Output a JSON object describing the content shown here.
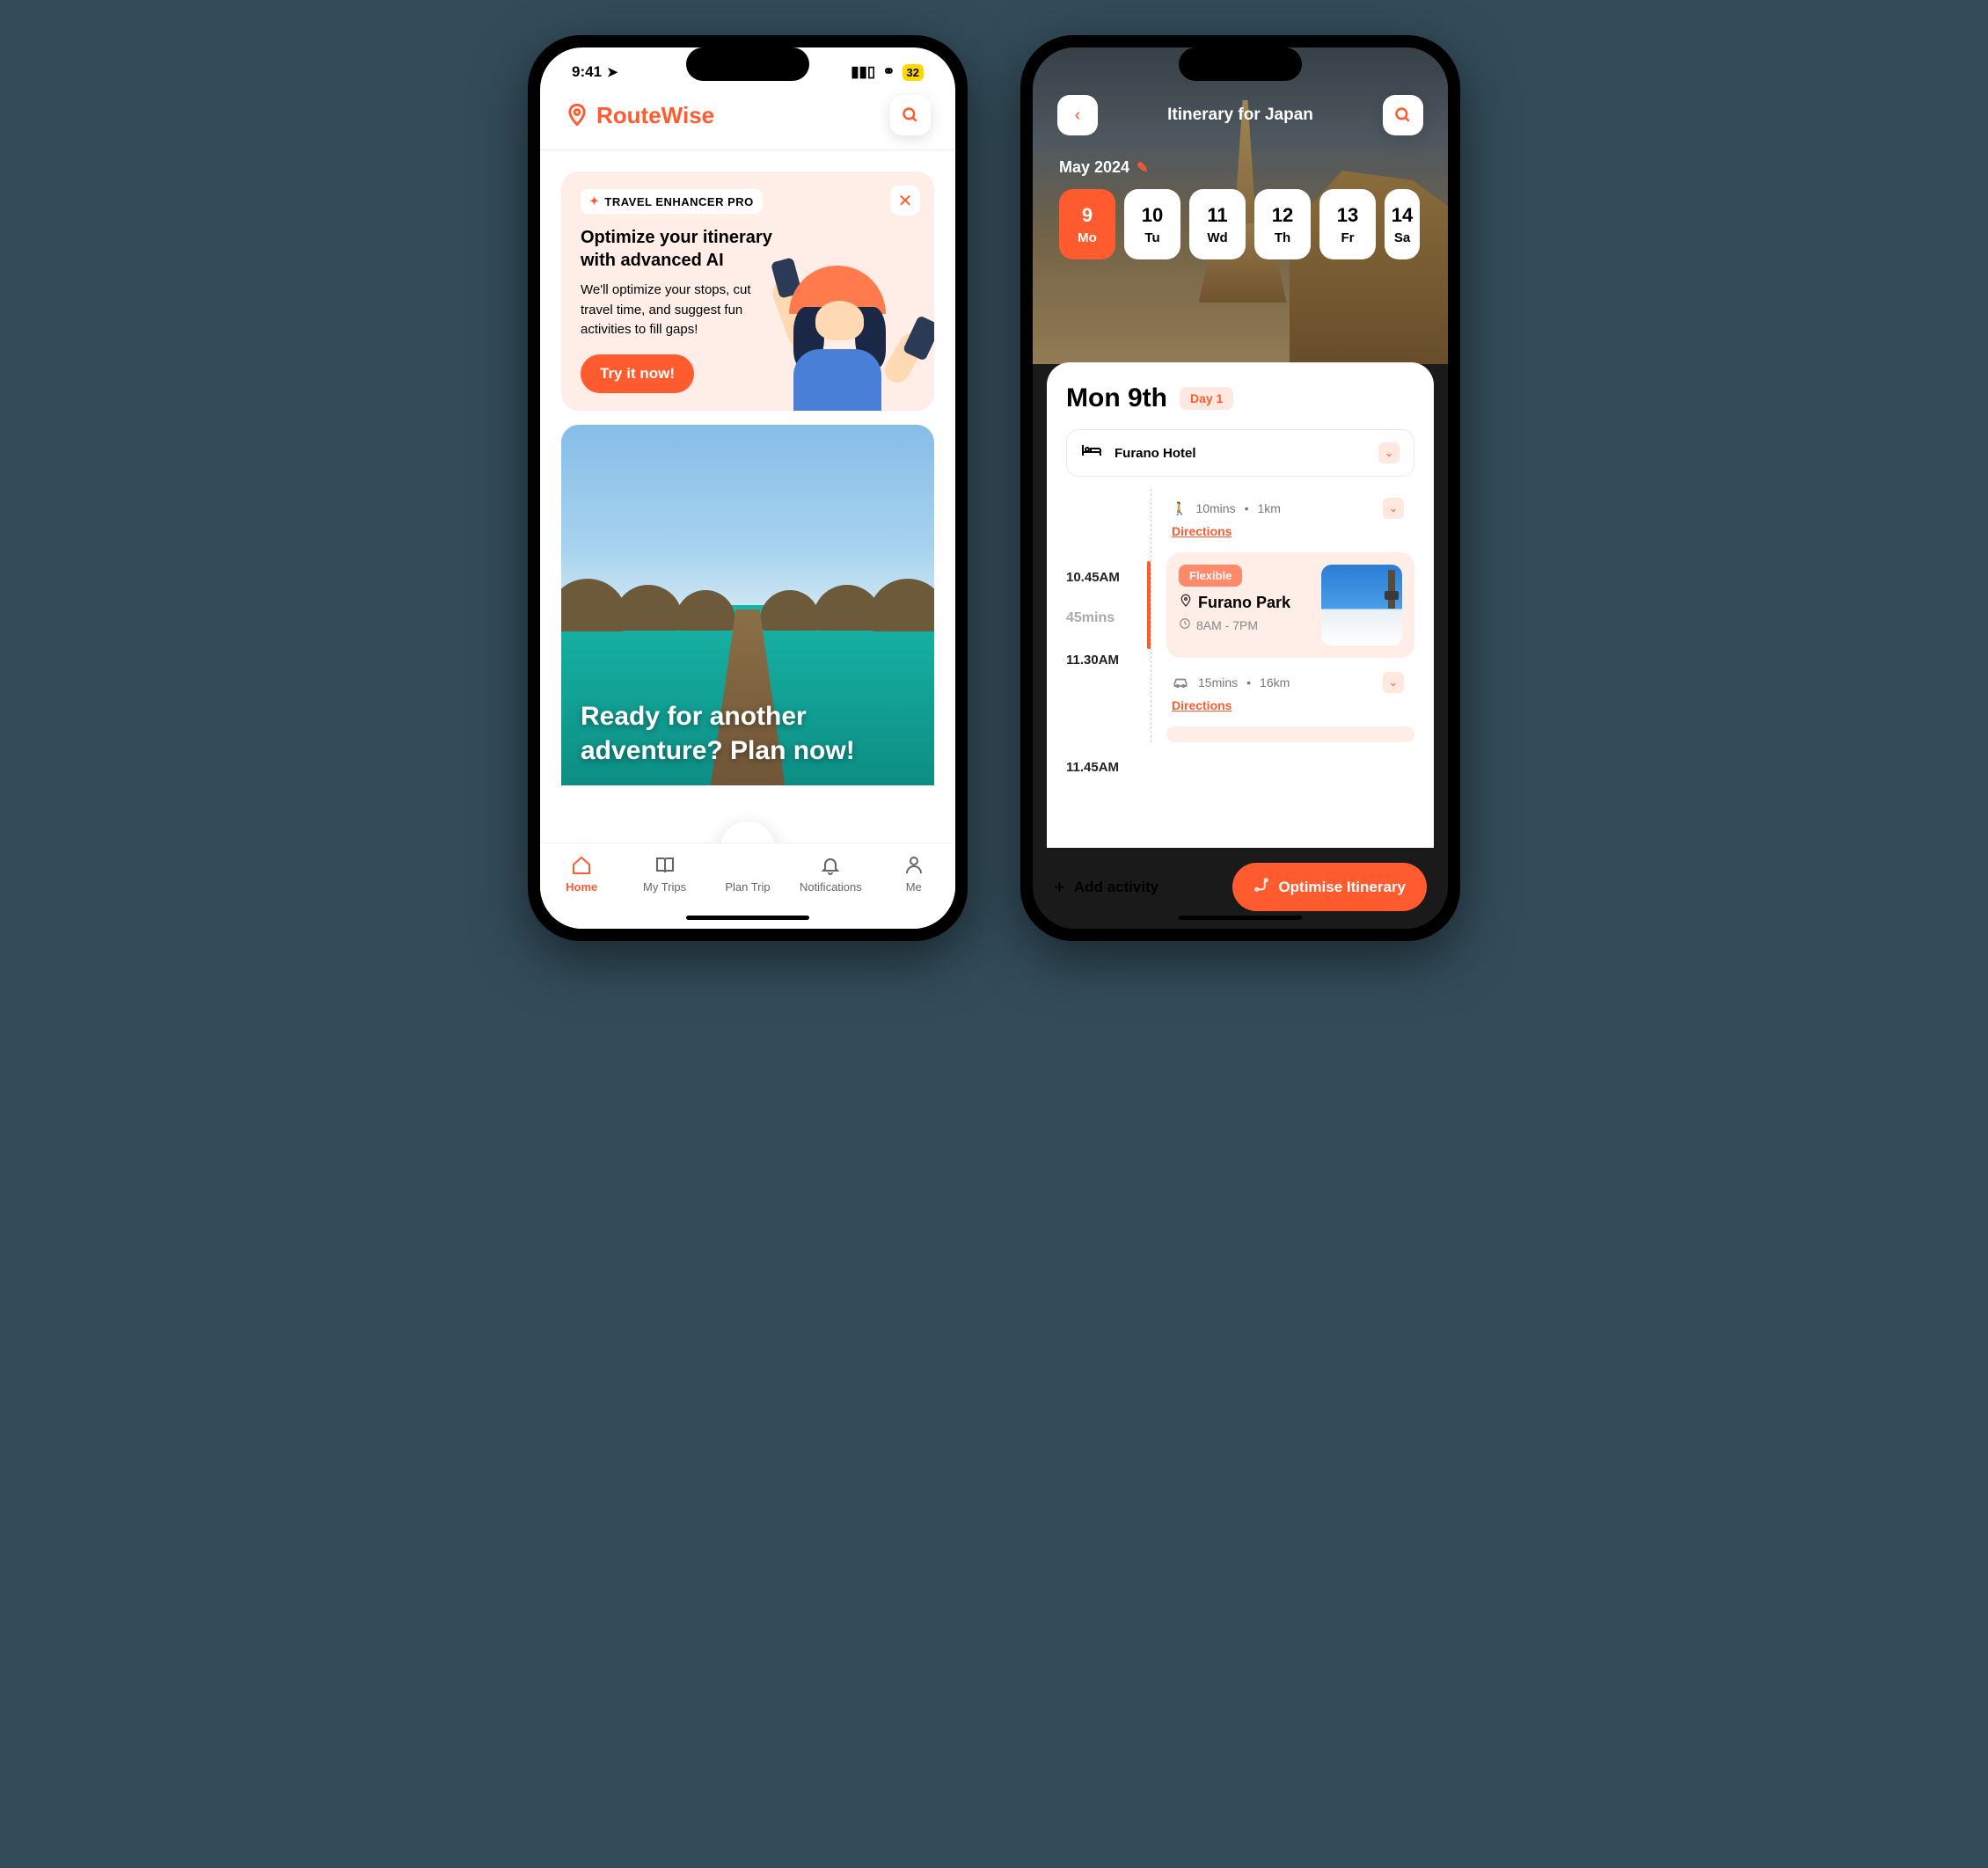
{
  "status": {
    "time": "9:41",
    "battery": "32"
  },
  "phone1": {
    "brand": "RouteWise",
    "promo": {
      "badge": "TRAVEL ENHANCER PRO",
      "title": "Optimize your itinerary with advanced AI",
      "desc": "We'll optimize your stops, cut travel time, and suggest fun activities to fill gaps!",
      "cta": "Try it now!"
    },
    "hero": "Ready for another adventure? Plan now!",
    "tabs": {
      "home": "Home",
      "trips": "My Trips",
      "plan": "Plan Trip",
      "notif": "Notifications",
      "me": "Me"
    }
  },
  "phone2": {
    "title": "Itinerary for Japan",
    "month": "May 2024",
    "days": [
      {
        "num": "9",
        "dow": "Mo"
      },
      {
        "num": "10",
        "dow": "Tu"
      },
      {
        "num": "11",
        "dow": "Wd"
      },
      {
        "num": "12",
        "dow": "Th"
      },
      {
        "num": "13",
        "dow": "Fr"
      },
      {
        "num": "14",
        "dow": "Sa"
      }
    ],
    "sheet": {
      "date": "Mon 9th",
      "dayBadge": "Day 1",
      "hotel": "Furano Hotel",
      "times": {
        "t1": "10.45AM",
        "dur": "45mins",
        "t2": "11.30AM",
        "t3": "11.45AM"
      },
      "seg1": {
        "time": "10mins",
        "dist": "1km",
        "link": "Directions"
      },
      "activity1": {
        "flex": "Flexible",
        "name": "Furano Park",
        "hours": "8AM - 7PM"
      },
      "seg2": {
        "time": "15mins",
        "dist": "16km",
        "link": "Directions"
      }
    },
    "actions": {
      "add": "Add activity",
      "optimise": "Optimise Itinerary"
    }
  }
}
